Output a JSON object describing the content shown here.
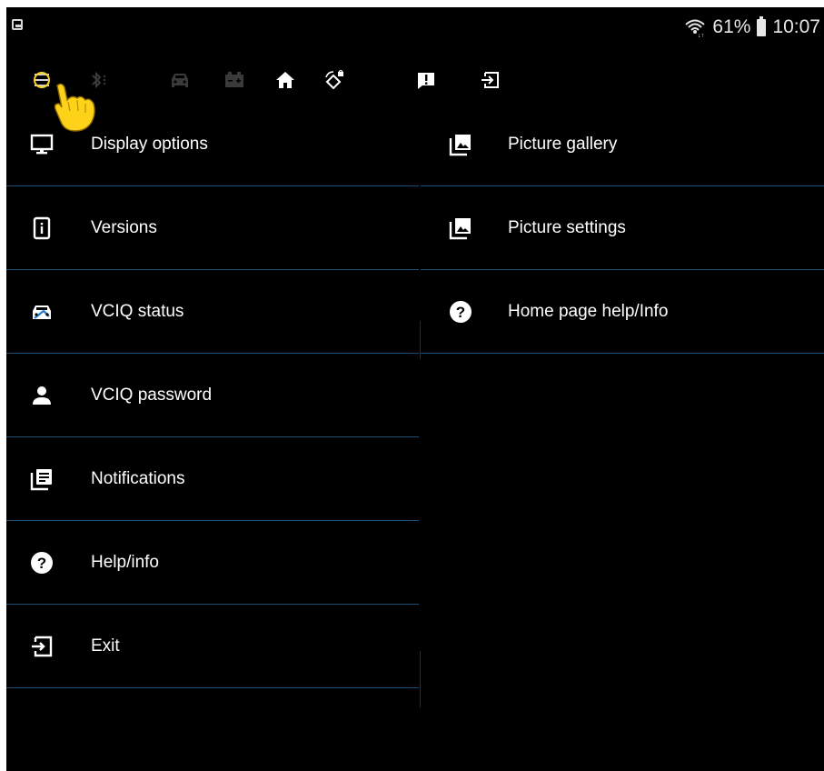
{
  "status_bar": {
    "battery_percent": "61%",
    "time": "10:07"
  },
  "toolbar": {
    "icons": [
      "menu-icon",
      "bluetooth-icon",
      "vehicle-icon",
      "battery-icon",
      "home-icon",
      "rotate-lock-icon",
      "alert-icon",
      "exit-icon"
    ]
  },
  "menu_left": [
    {
      "label": "Display options",
      "icon": "monitor-icon"
    },
    {
      "label": "Versions",
      "icon": "info-icon"
    },
    {
      "label": "VCIQ status",
      "icon": "vehicle-status-icon"
    },
    {
      "label": "VCIQ password",
      "icon": "person-icon"
    },
    {
      "label": "Notifications",
      "icon": "notifications-icon"
    },
    {
      "label": "Help/info",
      "icon": "help-icon"
    },
    {
      "label": "Exit",
      "icon": "exit-icon"
    }
  ],
  "menu_right": [
    {
      "label": "Picture gallery",
      "icon": "picture-icon"
    },
    {
      "label": "Picture settings",
      "icon": "picture-icon"
    },
    {
      "label": "Home page help/Info",
      "icon": "help-icon"
    }
  ],
  "colors": {
    "background": "#000000",
    "divider": "#1a4f78",
    "text": "#ffffff",
    "pointer": "#ffd21a"
  }
}
